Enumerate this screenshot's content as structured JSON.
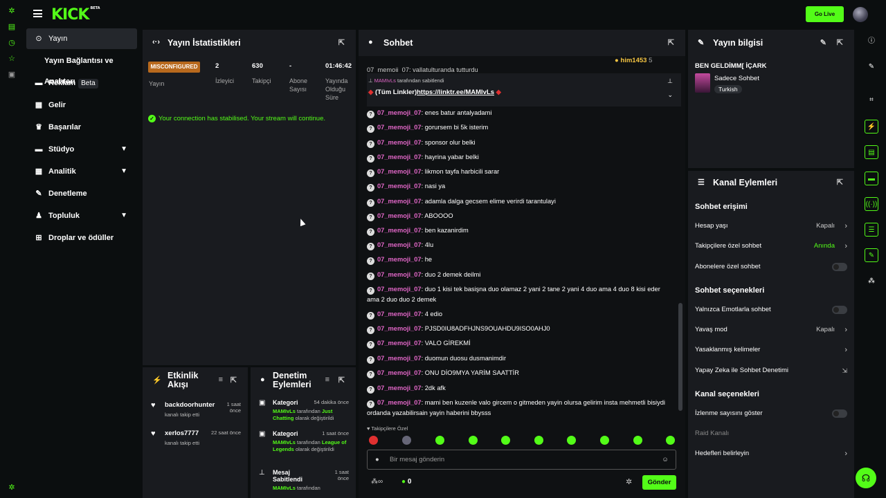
{
  "app": {
    "logo": "KICK",
    "logo_tag": "BETA",
    "go_live": "Go Live"
  },
  "sidebar": {
    "items": [
      {
        "label": "Yayın",
        "icon": "broadcast-icon"
      },
      {
        "label": "Yayın Bağlantısı ve Anahtarı",
        "icon": ""
      },
      {
        "label": "Reklam",
        "icon": "ad-icon",
        "badge": "Beta"
      },
      {
        "label": "Gelir",
        "icon": "revenue-icon"
      },
      {
        "label": "Başarılar",
        "icon": "trophy-icon"
      },
      {
        "label": "Stüdyo",
        "icon": "studio-icon"
      },
      {
        "label": "Analitik",
        "icon": "analytics-icon"
      },
      {
        "label": "Denetleme",
        "icon": "wrench-icon"
      },
      {
        "label": "Topluluk",
        "icon": "community-icon"
      },
      {
        "label": "Droplar ve ödüller",
        "icon": "drops-icon"
      }
    ]
  },
  "stats": {
    "title": "Yayın İstatistikleri",
    "status": "MISCONFIGURED",
    "status_label": "Yayın",
    "viewers": "2",
    "viewers_label": "İzleyici",
    "followers": "630",
    "followers_label": "Takipçi",
    "subs": "-",
    "subs_label": "Abone Sayısı",
    "uptime": "01:46:42",
    "uptime_label": "Yayında Olduğu Süre",
    "connection_msg": "Your connection has stabilised. Your stream will continue."
  },
  "activity": {
    "title": "Etkinlik Akışı",
    "items": [
      {
        "name": "backdoorhunter",
        "sub": "kanalı takip etti",
        "time": "1 saat önce"
      },
      {
        "name": "xerlos7777",
        "sub": "kanalı takip etti",
        "time": "22 saat önce"
      }
    ]
  },
  "moderation": {
    "title": "Denetim Eylemleri",
    "items": [
      {
        "name": "Kategori",
        "time": "54 dakika önce",
        "user": "MAMIvLs",
        "pre": "tarafından",
        "target": "Just Chatting",
        "post": "olarak değiştirildi"
      },
      {
        "name": "Kategori",
        "time": "1 saat önce",
        "user": "MAMIvLs",
        "pre": "tarafından",
        "target": "League of Legends",
        "post": "olarak değiştirildi"
      },
      {
        "name": "Mesaj Sabitlendi",
        "time": "1 saat önce",
        "user": "MAMIvLs",
        "pre": "tarafından",
        "target": "",
        "post": ""
      }
    ]
  },
  "chat": {
    "title": "Sohbet",
    "top_user": "him1453",
    "top_count": "5",
    "partial_msg": "07_memoji_07: vallatulturanda tutturdu",
    "pinned_by": "MAMIvLs",
    "pinned_by_suffix": "tarafından sabitlendi",
    "pinned_prefix": "(Tüm Linkler)",
    "pinned_link": "https://linktr.ee/MAMIvLs",
    "messages": [
      {
        "user": "07_memoji_07",
        "text": "enes batur antalyadami"
      },
      {
        "user": "07_memoji_07",
        "text": "gorursem bi 5k isterim"
      },
      {
        "user": "07_memoji_07",
        "text": "sponsor olur belki"
      },
      {
        "user": "07_memoji_07",
        "text": "hayrina yabar belki"
      },
      {
        "user": "07_memoji_07",
        "text": "likmon tayfa harbicili sarar"
      },
      {
        "user": "07_memoji_07",
        "text": "nasi ya"
      },
      {
        "user": "07_memoji_07",
        "text": "adamla dalga gecsem elime verirdi tarantulayi"
      },
      {
        "user": "07_memoji_07",
        "text": "ABOOOO"
      },
      {
        "user": "07_memoji_07",
        "text": "ben kazanirdim"
      },
      {
        "user": "07_memoji_07",
        "text": "4lu"
      },
      {
        "user": "07_memoji_07",
        "text": "he"
      },
      {
        "user": "07_memoji_07",
        "text": "duo 2 demek deilmi"
      },
      {
        "user": "07_memoji_07",
        "text": "duo 1 kisi tek basişna duo olamaz 2 yani 2 tane 2 yani 4 duo ama 4 duo 8 kisi eder ama 2 duo duo 2 demek"
      },
      {
        "user": "07_memoji_07",
        "text": "4 edio"
      },
      {
        "user": "07_memoji_07",
        "text": "PJSD0IU8ADFHJNS9OUAHDU9ISO0AHJ0"
      },
      {
        "user": "07_memoji_07",
        "text": "VALO GİREKMİ"
      },
      {
        "user": "07_memoji_07",
        "text": "duomun duosu dusmanimdir"
      },
      {
        "user": "07_memoji_07",
        "text": "ONU DİO9MYA YARİM SAATTİR"
      },
      {
        "user": "07_memoji_07",
        "text": "2dk afk"
      },
      {
        "user": "07_memoji_07",
        "text": "mami ben kuzenle valo gircem o gitmeden yayin olursa gelirim insta mehmetli bisiydi ordanda yazabilirsain yayin haberini bbysss"
      }
    ],
    "followers_only": "Takipçilere Özel",
    "placeholder": "Bir mesaj gönderin",
    "points": "0",
    "send": "Gönder"
  },
  "info": {
    "title": "Yayın bilgisi",
    "stream_title": "BEN GELDİMM[ İÇARK",
    "category": "Sadece Sohbet",
    "language": "Turkish"
  },
  "channel": {
    "title": "Kanal Eylemleri",
    "access_title": "Sohbet erişimi",
    "account_age": "Hesap yaşı",
    "account_age_val": "Kapalı",
    "followers_chat": "Takipçilere özel sohbet",
    "followers_chat_val": "Anında",
    "subs_chat": "Abonelere özel sohbet",
    "options_title": "Sohbet seçenekleri",
    "emote_only": "Yalnızca Emotlarla sohbet",
    "slow_mode": "Yavaş mod",
    "slow_mode_val": "Kapalı",
    "banned_words": "Yasaklanmış kelimeler",
    "ai_mod": "Yapay Zeka ile Sohbet Denetimi",
    "channel_opts": "Kanal seçenekleri",
    "show_viewers": "İzlenme sayısını göster",
    "raid": "Raid Kanalı",
    "goals": "Hedefleri belirleyin"
  },
  "colors": {
    "accent": "#53fc18",
    "panel": "#191b1f",
    "bg": "#0b0e0f",
    "username": "#e066c6",
    "warning": "#b8691d"
  }
}
